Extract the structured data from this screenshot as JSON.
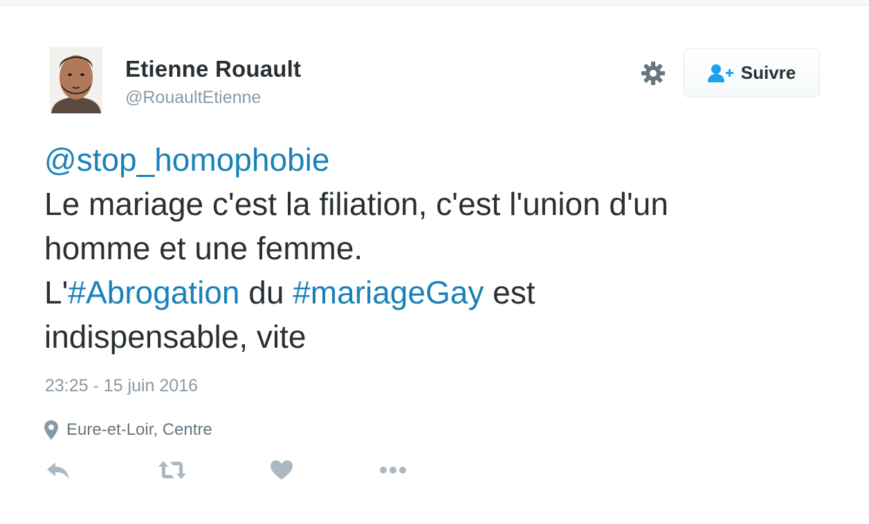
{
  "user": {
    "fullname": "Etienne Rouault",
    "handle": "@RouaultEtienne"
  },
  "follow_button": {
    "label": "Suivre",
    "icon": "add-user-icon"
  },
  "settings": {
    "icon": "gear-icon"
  },
  "tweet": {
    "mention": "@stop_homophobie",
    "line1": "Le mariage c'est la filiation, c'est l'union d'un",
    "line2": "homme et une femme.",
    "line3_prefix": "L'",
    "hashtag1": "#Abrogation",
    "line3_mid": " du ",
    "hashtag2": "#mariageGay",
    "line3_suffix": " est",
    "line4": "indispensable, vite"
  },
  "timestamp": "23:25 - 15 juin 2016",
  "location": {
    "icon": "location-pin-icon",
    "text": "Eure-et-Loir, Centre"
  },
  "actions": [
    {
      "icon": "reply-icon"
    },
    {
      "icon": "retweet-icon"
    },
    {
      "icon": "like-heart-icon"
    },
    {
      "icon": "more-options-icon"
    }
  ],
  "colors": {
    "link": "#1a81b8",
    "text": "#292f33",
    "muted": "#8899a6",
    "icon": "#aab8c2",
    "follow_icon": "#1da1f2"
  }
}
